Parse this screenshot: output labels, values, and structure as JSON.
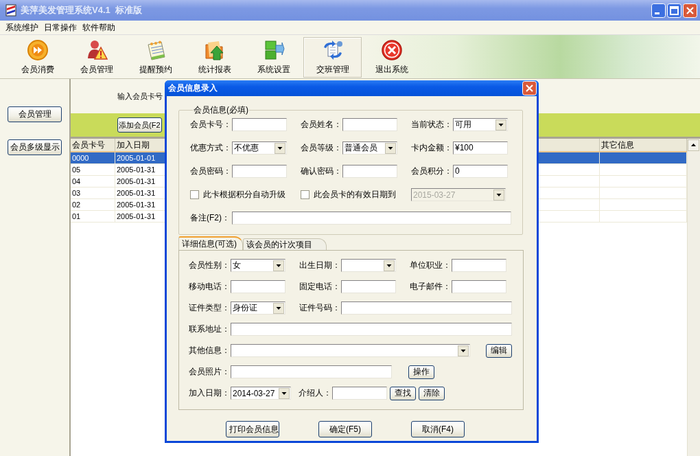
{
  "window": {
    "title": "美萍美发管理系统V4.1  标准版"
  },
  "menu": [
    "系统维护",
    "日常操作",
    "软件帮助"
  ],
  "toolbar": [
    {
      "label": "会员消费",
      "selected": false
    },
    {
      "label": "会员管理",
      "selected": false
    },
    {
      "label": "提醒预约",
      "selected": false
    },
    {
      "label": "统计报表",
      "selected": false
    },
    {
      "label": "系统设置",
      "selected": false
    },
    {
      "label": "交班管理",
      "selected": true
    },
    {
      "label": "退出系统",
      "selected": false
    }
  ],
  "sidebar": {
    "buttons": [
      "会员管理",
      "会员多级显示"
    ]
  },
  "search": {
    "label": "输入会员卡号"
  },
  "add_button": "添加会员(F2",
  "table": {
    "columns": [
      "会员卡号",
      "加入日期",
      "其它信息"
    ],
    "rows": [
      {
        "cells": [
          "0000",
          "2005-01-01"
        ],
        "selected": true
      },
      {
        "cells": [
          "05",
          "2005-01-31"
        ],
        "selected": false
      },
      {
        "cells": [
          "04",
          "2005-01-31"
        ],
        "selected": false
      },
      {
        "cells": [
          "03",
          "2005-01-31"
        ],
        "selected": false
      },
      {
        "cells": [
          "02",
          "2005-01-31"
        ],
        "selected": false
      },
      {
        "cells": [
          "01",
          "2005-01-31"
        ],
        "selected": false
      }
    ]
  },
  "dialog": {
    "title": "会员信息录入",
    "group": {
      "legend": "会员信息(必填)",
      "rows": [
        [
          {
            "kind": "input",
            "label": "会员卡号："
          },
          {
            "kind": "input",
            "label": "会员姓名："
          },
          {
            "kind": "select",
            "label": "当前状态：",
            "value": "可用"
          }
        ],
        [
          {
            "kind": "select",
            "label": "优惠方式：",
            "value": "不优惠"
          },
          {
            "kind": "select",
            "label": "会员等级：",
            "value": "普通会员"
          },
          {
            "kind": "input",
            "label": "卡内金额：",
            "value": "¥100"
          }
        ],
        [
          {
            "kind": "input",
            "label": "会员密码："
          },
          {
            "kind": "input",
            "label": "确认密码："
          },
          {
            "kind": "input",
            "label": "会员积分：",
            "value": "0"
          }
        ],
        [
          {
            "kind": "checkbox",
            "text": "此卡根据积分自动升级",
            "checked": false
          },
          {
            "kind": "checkbox",
            "text": "此会员卡的有效日期到",
            "checked": false
          },
          {
            "kind": "select",
            "value": "2015-03-27",
            "disabled": true
          }
        ],
        [
          {
            "kind": "input",
            "label": "备注(F2)："
          }
        ]
      ]
    },
    "tabs": [
      {
        "label": "详细信息(可选)",
        "selected": true
      },
      {
        "label": "该会员的计次项目",
        "selected": false
      }
    ],
    "panel": {
      "rows": [
        [
          {
            "kind": "select",
            "label": "会员性别：",
            "value": "女"
          },
          {
            "kind": "select",
            "label": "出生日期："
          },
          {
            "kind": "input",
            "label": "单位职业："
          }
        ],
        [
          {
            "kind": "input",
            "label": "移动电话："
          },
          {
            "kind": "input",
            "label": "固定电话："
          },
          {
            "kind": "input",
            "label": "电子邮件："
          }
        ],
        [
          {
            "kind": "select",
            "label": "证件类型：",
            "value": "身份证"
          },
          {
            "kind": "input",
            "label": "证件号码："
          }
        ],
        [
          {
            "kind": "input",
            "label": "联系地址："
          }
        ],
        [
          {
            "kind": "select",
            "label": "其他信息：",
            "button": "编辑"
          }
        ],
        [
          {
            "kind": "input",
            "label": "会员照片：",
            "button": "操作"
          }
        ],
        [
          {
            "kind": "select",
            "label": "加入日期：",
            "value": "2014-03-27"
          },
          {
            "kind": "input",
            "label": "介绍人："
          },
          {
            "kind": "button",
            "text": "查找"
          },
          {
            "kind": "button",
            "text": "清除"
          }
        ]
      ]
    },
    "buttons": [
      "打印会员信息",
      "确定(F5)",
      "取消(F4)"
    ]
  }
}
